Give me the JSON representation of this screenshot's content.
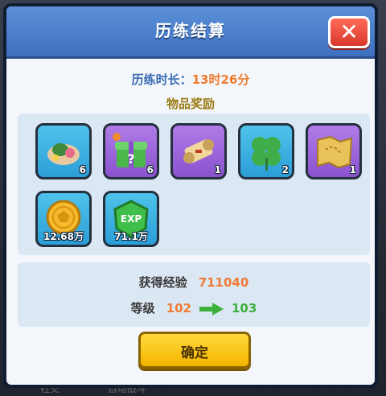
{
  "dialog": {
    "title": "历练结算",
    "duration_label": "历练时长：",
    "duration_value": "13时26分",
    "rewards_title": "物品奖励"
  },
  "rewards": [
    {
      "icon": "fish-food-icon",
      "qty": "6",
      "rarity": "blue"
    },
    {
      "icon": "mystery-gift-box-icon",
      "qty": "6",
      "rarity": "purple"
    },
    {
      "icon": "scroll-icon",
      "qty": "1",
      "rarity": "purple"
    },
    {
      "icon": "four-leaf-clover-icon",
      "qty": "2",
      "rarity": "blue"
    },
    {
      "icon": "treasure-map-icon",
      "qty": "1",
      "rarity": "purple"
    },
    {
      "icon": "gold-coin-icon",
      "qty": "12.68万",
      "rarity": "blue"
    },
    {
      "icon": "exp-gem-icon",
      "qty": "71.1万",
      "rarity": "blue",
      "badge": "EXP"
    }
  ],
  "exp": {
    "label": "获得经验",
    "value": "711040"
  },
  "level": {
    "label": "等级",
    "from": "102",
    "to": "103"
  },
  "confirm_label": "确定",
  "background": {
    "bottom_left": "社交",
    "bottom_mid": "自动战斗"
  },
  "colors": {
    "header": "#4a7fcc",
    "accent_orange": "#ef7b35",
    "accent_green": "#3bb13b",
    "close": "#e0412f",
    "confirm": "#f7c21a"
  }
}
